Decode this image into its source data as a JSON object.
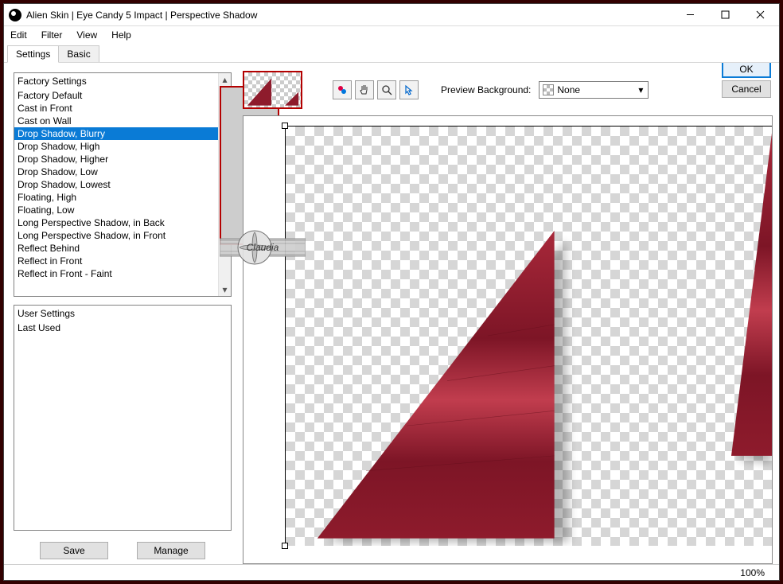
{
  "window": {
    "title": "Alien Skin | Eye Candy 5 Impact | Perspective Shadow"
  },
  "menu": {
    "edit": "Edit",
    "filter": "Filter",
    "view": "View",
    "help": "Help"
  },
  "tabs": {
    "settings": "Settings",
    "basic": "Basic"
  },
  "factory": {
    "header": "Factory Settings",
    "items": [
      "Factory Default",
      "Cast in Front",
      "Cast on Wall",
      "Drop Shadow, Blurry",
      "Drop Shadow, High",
      "Drop Shadow, Higher",
      "Drop Shadow, Low",
      "Drop Shadow, Lowest",
      "Floating, High",
      "Floating, Low",
      "Long Perspective Shadow, in Back",
      "Long Perspective Shadow, in Front",
      "Reflect Behind",
      "Reflect in Front",
      "Reflect in Front - Faint"
    ],
    "selected_index": 3
  },
  "user": {
    "header": "User Settings",
    "items": [
      "Last Used"
    ]
  },
  "buttons": {
    "save": "Save",
    "manage": "Manage",
    "ok": "OK",
    "cancel": "Cancel"
  },
  "preview_bg": {
    "label": "Preview Background:",
    "value": "None"
  },
  "status": {
    "zoom": "100%"
  },
  "watermark_text": "Claudia"
}
